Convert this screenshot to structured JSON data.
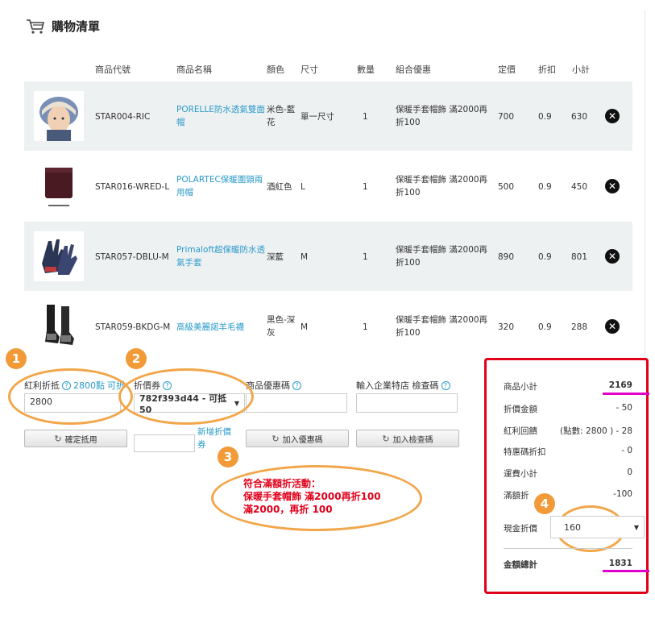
{
  "page": {
    "title": "購物清單",
    "cart_icon": "cart-icon"
  },
  "columns": [
    "商品代號",
    "商品名稱",
    "顏色",
    "尺寸",
    "數量",
    "組合優惠",
    "定價",
    "折扣",
    "小計"
  ],
  "items": [
    {
      "code": "STAR004-RIC",
      "name": "PORELLE防水透氣雙面帽",
      "color": "米色-藍花",
      "size": "單一尺寸",
      "qty": "1",
      "promo": "保暖手套帽飾 滿2000再折100",
      "price": "700",
      "discount": "0.9",
      "subtotal": "630",
      "thumb": "hat"
    },
    {
      "code": "STAR016-WRED-L",
      "name": "POLARTEC保暖圍頸兩用帽",
      "color": "酒紅色",
      "size": "L",
      "qty": "1",
      "promo": "保暖手套帽飾 滿2000再折100",
      "price": "500",
      "discount": "0.9",
      "subtotal": "450",
      "thumb": "neck"
    },
    {
      "code": "STAR057-DBLU-M",
      "name": "Primaloft超保暖防水透氣手套",
      "color": "深藍",
      "size": "M",
      "qty": "1",
      "promo": "保暖手套帽飾 滿2000再折100",
      "price": "890",
      "discount": "0.9",
      "subtotal": "801",
      "thumb": "gloves"
    },
    {
      "code": "STAR059-BKDG-M",
      "name": "高級美麗諾羊毛襪",
      "color": "黑色-深灰",
      "size": "M",
      "qty": "1",
      "promo": "保暖手套帽飾 滿2000再折100",
      "price": "320",
      "discount": "0.9",
      "subtotal": "288",
      "thumb": "socks"
    }
  ],
  "bonus": {
    "label": "紅利折抵",
    "points": "2800點",
    "suffix": "可折",
    "value": "2800",
    "confirm": "確定抵用"
  },
  "coupon": {
    "label": "折價券",
    "selected": "782f393d44 - 可抵 50",
    "add_link": "新增折價券"
  },
  "promo_code": {
    "label": "商品優惠碼",
    "value": "",
    "button": "加入優惠碼"
  },
  "enterprise": {
    "label": "輸入企業特店 檢查碼",
    "value": "",
    "button": "加入檢查碼"
  },
  "badges": [
    "1",
    "2",
    "3",
    "4"
  ],
  "promo_message": {
    "line1": "符合滿額折活動：",
    "line2": "保暖手套帽飾 滿2000再折100",
    "line3": "滿2000，再折 100"
  },
  "summary": {
    "subtotal_label": "商品小計",
    "subtotal": "2169",
    "discount_label": "折價金額",
    "discount": "- 50",
    "bonus_label": "紅利回饋",
    "bonus": "(點數: 2800 ) - 28",
    "special_label": "特惠碼折扣",
    "special": "- 0",
    "shipping_label": "運費小計",
    "shipping": "0",
    "full_label": "滿額折",
    "full": "-100",
    "cash_label": "現金折價",
    "cash": "160",
    "total_label": "金額總計",
    "total": "1831"
  },
  "colors": {
    "accent": "#2a9ac9",
    "badge": "#f29a38",
    "highlight": "#e1001a",
    "underline": "#e100c8"
  }
}
